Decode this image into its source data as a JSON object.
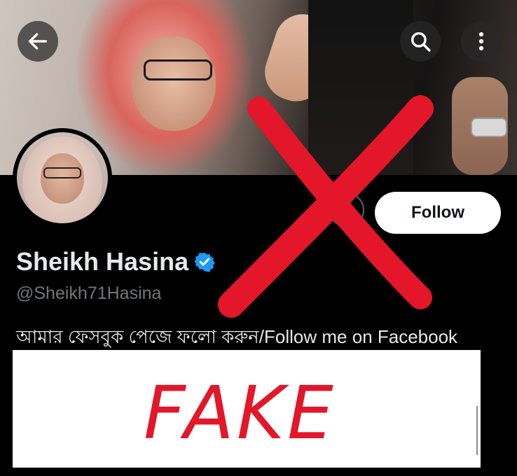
{
  "header": {
    "back_icon": "arrow-left-icon",
    "search_icon": "search-icon",
    "more_icon": "more-vertical-icon"
  },
  "profile": {
    "display_name": "Sheikh Hasina",
    "verified": true,
    "verified_color": "#1d9bf0",
    "handle": "@Sheikh71Hasina",
    "bio": "আমার ফেসবুক পেজে ফলো করুন/Follow me on Facebook"
  },
  "actions": {
    "follow_label": "Follow",
    "message_icon": "message-icon"
  },
  "overlay": {
    "stamp_text": "FAKE",
    "stamp_color": "#e3162a",
    "cross_color": "#e3162a"
  }
}
